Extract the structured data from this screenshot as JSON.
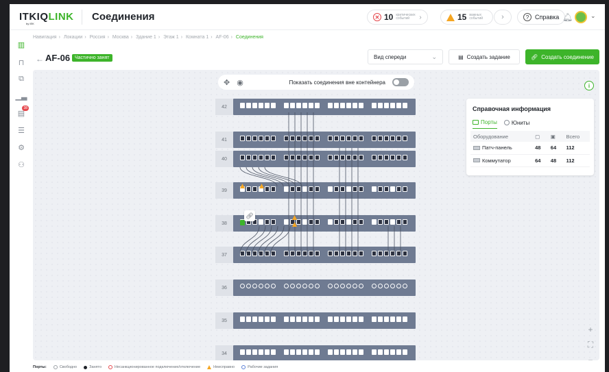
{
  "app": {
    "logo_main": "ITKIQ",
    "logo_accent": "LINK",
    "logo_sub": "by IEK",
    "page_title": "Соединения"
  },
  "header": {
    "critical_count": "10",
    "critical_label": "критических событий",
    "important_count": "15",
    "important_label": "важных событий",
    "help_label": "Справка"
  },
  "breadcrumbs": [
    "Навигация",
    "Локации",
    "Россия",
    "Москва",
    "Здание 1",
    "Этаж 1",
    "Комната 1",
    "AF-06",
    "Соединения"
  ],
  "rack": {
    "name": "AF-06",
    "status": "Частично занят"
  },
  "controls": {
    "view_select": "Вид спереди",
    "create_task": "Создать задание",
    "create_connection": "Создать соединение",
    "show_outside": "Показать соединения вне контейнера"
  },
  "sidebar": {
    "badge": "38"
  },
  "info_card": {
    "title": "Справочная информация",
    "tab_ports": "Порты",
    "tab_units": "Юниты",
    "headers": [
      "Оборудование",
      "",
      "",
      "Всего"
    ],
    "rows": [
      {
        "name": "Патч-панель",
        "a": "48",
        "b": "64",
        "total": "112"
      },
      {
        "name": "Коммутатор",
        "a": "64",
        "b": "48",
        "total": "112"
      }
    ]
  },
  "units": [
    "42",
    "41",
    "40",
    "39",
    "38",
    "37",
    "36",
    "35",
    "34"
  ],
  "legend": {
    "title": "Порты:",
    "free": "Свободно",
    "busy": "Занято",
    "unauth": "Несанкционированное подключение/отключение",
    "faulty": "Неисправно",
    "tasks": "Рабочие задания"
  },
  "colors": {
    "accent": "#3db42a",
    "rack_panel": "#6f7b92",
    "critical": "#e5484d",
    "warning": "#f5a623"
  }
}
